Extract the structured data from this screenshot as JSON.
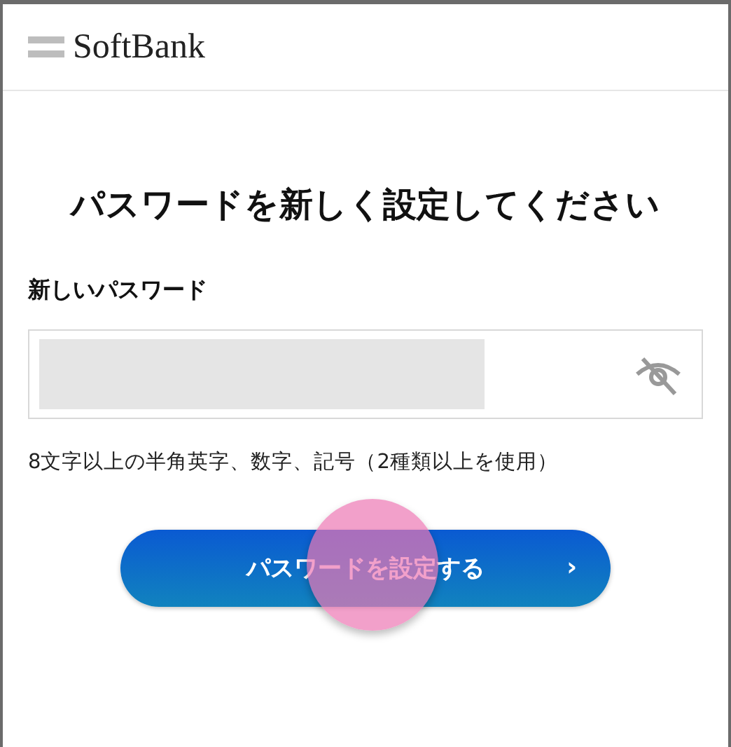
{
  "header": {
    "logo_text": "SoftBank"
  },
  "title": "パスワードを新しく設定してください",
  "password_field": {
    "label": "新しいパスワード",
    "password_visible": false
  },
  "hint": "8文字以上の半角英字、数字、記号（2種類以上を使用）",
  "submit_button": {
    "label": "パスワードを設定する",
    "chevron": "›"
  }
}
